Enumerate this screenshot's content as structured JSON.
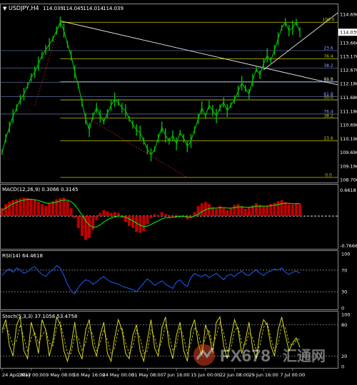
{
  "chart_data": [
    {
      "type": "line",
      "panel": "price",
      "title": "USDJPY,H4",
      "ohlc_header": [
        "114.039",
        "114.045",
        "114.014",
        "114.039"
      ],
      "current_price": "114.039",
      "ylim": [
        108.7,
        114.69
      ],
      "y_ticks": [
        "114.690",
        "113.660",
        "113.170",
        "112.670",
        "112.180",
        "111.680",
        "111.180",
        "110.690",
        "110.190",
        "109.690",
        "109.190",
        "108.700"
      ],
      "x_labels": [
        "24 Apr 2017",
        "2 May 00:00",
        "9 May 08:00",
        "16 May 16:00",
        "24 May 00:00",
        "31 May 08:00",
        "7 Jun 16:00",
        "15 Jun 00:00",
        "22 Jun 08:00",
        "29 Jun 16:00",
        "7 Jul 00:00"
      ],
      "x_index": [
        0,
        8,
        16,
        24,
        32,
        40,
        48,
        56,
        64,
        72,
        80
      ],
      "series": [
        {
          "values": [
            109.7,
            110.2,
            110.6,
            111.0,
            111.3,
            111.6,
            111.8,
            112.1,
            112.4,
            112.6,
            112.9,
            113.2,
            113.4,
            113.6,
            113.8,
            114.1,
            114.4,
            114.1,
            113.6,
            113.2,
            112.6,
            112.1,
            111.5,
            110.9,
            110.5,
            111.0,
            111.3,
            111.0,
            110.8,
            111.1,
            111.4,
            111.6,
            111.5,
            111.3,
            111.2,
            110.9,
            110.7,
            110.5,
            110.4,
            110.1,
            109.8,
            109.6,
            109.8,
            110.2,
            110.6,
            110.3,
            110.1,
            110.3,
            110.0,
            110.4,
            110.2,
            109.9,
            110.1,
            110.5,
            110.9,
            111.3,
            111.0,
            111.4,
            111.2,
            111.0,
            111.3,
            111.5,
            111.2,
            111.4,
            111.6,
            111.9,
            112.2,
            112.0,
            111.8,
            112.3,
            112.7,
            112.5,
            112.9,
            113.2,
            113.0,
            113.4,
            113.8,
            114.2,
            114.4,
            114.1,
            114.2,
            114.4,
            114.039
          ]
        }
      ],
      "fibonacci_left": {
        "high": 114.4,
        "low": 108.78,
        "levels": [
          "100.0",
          "76.4",
          "61.8",
          "50.0",
          "38.2",
          "23.6",
          "0.0"
        ]
      },
      "fibonacci_right": {
        "low": 110.05,
        "high": 114.4,
        "levels": [
          "23.6",
          "38.2",
          "50.0",
          "61.8",
          "76.4"
        ]
      },
      "trendlines": [
        {
          "from": [
            16,
            114.45
          ],
          "to": [
            82,
            112.45
          ]
        },
        {
          "from": [
            72,
            112.68
          ],
          "to": [
            82,
            113.69
          ]
        }
      ],
      "colors": {
        "price": "#00c000",
        "fib": "#c8c800",
        "grid": "#5a6a9a",
        "text": "#ffffff",
        "trend": "#e8e8e8"
      }
    },
    {
      "type": "bar",
      "panel": "macd",
      "title": "MACD(12,26,9) 0.3066 0.3145",
      "y_labels": [
        "0.6618",
        "-0.7666"
      ],
      "ylim": [
        -0.7666,
        0.6618
      ],
      "values": [
        0.2,
        0.3,
        0.36,
        0.4,
        0.42,
        0.44,
        0.46,
        0.45,
        0.43,
        0.4,
        0.36,
        0.3,
        0.25,
        0.32,
        0.38,
        0.42,
        0.45,
        0.46,
        0.38,
        0.2,
        -0.05,
        -0.3,
        -0.5,
        -0.6,
        -0.55,
        -0.35,
        -0.1,
        0.08,
        0.15,
        0.12,
        0.08,
        0.1,
        0.08,
        -0.05,
        -0.15,
        -0.25,
        -0.3,
        -0.4,
        -0.42,
        -0.38,
        -0.2,
        -0.05,
        0.05,
        -0.02,
        0.1,
        0.05,
        -0.05,
        -0.02,
        0.03,
        0.02,
        -0.02,
        -0.08,
        -0.05,
        0.1,
        0.25,
        0.32,
        0.35,
        0.3,
        0.22,
        0.18,
        0.25,
        0.2,
        0.15,
        0.2,
        0.28,
        0.3,
        0.25,
        0.18,
        0.22,
        0.27,
        0.32,
        0.28,
        0.24,
        0.26,
        0.3,
        0.33,
        0.37,
        0.4,
        0.35,
        0.3,
        0.29,
        0.31,
        0.3066
      ],
      "signal": [
        0.15,
        0.2,
        0.26,
        0.31,
        0.35,
        0.38,
        0.4,
        0.42,
        0.42,
        0.41,
        0.39,
        0.36,
        0.33,
        0.32,
        0.33,
        0.35,
        0.38,
        0.4,
        0.4,
        0.36,
        0.28,
        0.16,
        0.02,
        -0.12,
        -0.22,
        -0.28,
        -0.27,
        -0.22,
        -0.15,
        -0.09,
        -0.05,
        -0.02,
        0.0,
        0.0,
        -0.03,
        -0.07,
        -0.12,
        -0.18,
        -0.23,
        -0.26,
        -0.25,
        -0.21,
        -0.16,
        -0.12,
        -0.07,
        -0.04,
        -0.04,
        -0.03,
        -0.02,
        -0.01,
        -0.01,
        -0.02,
        -0.03,
        0.0,
        0.05,
        0.11,
        0.16,
        0.19,
        0.2,
        0.2,
        0.21,
        0.21,
        0.2,
        0.2,
        0.21,
        0.23,
        0.23,
        0.22,
        0.22,
        0.23,
        0.25,
        0.25,
        0.25,
        0.25,
        0.26,
        0.27,
        0.29,
        0.31,
        0.32,
        0.32,
        0.31,
        0.31,
        0.3145
      ],
      "colors": {
        "bars": "#c00000",
        "signal": "#00ff00",
        "zero": "#ffffff"
      }
    },
    {
      "type": "line",
      "panel": "rsi",
      "title": "RSI(14) 64.4618",
      "y_labels": [
        "100",
        "70",
        "30",
        "0"
      ],
      "levels": [
        70,
        30
      ],
      "ylim": [
        0,
        100
      ],
      "values": [
        60,
        68,
        72,
        66,
        74,
        70,
        64,
        67,
        73,
        76,
        68,
        62,
        58,
        66,
        70,
        78,
        74,
        60,
        44,
        32,
        26,
        38,
        46,
        52,
        50,
        44,
        48,
        54,
        58,
        52,
        48,
        46,
        44,
        40,
        38,
        36,
        34,
        30,
        38,
        46,
        54,
        48,
        42,
        46,
        50,
        44,
        40,
        36,
        48,
        52,
        44,
        40,
        56,
        64,
        60,
        58,
        62,
        56,
        60,
        64,
        58,
        52,
        60,
        62,
        58,
        64,
        68,
        62,
        60,
        66,
        70,
        64,
        60,
        66,
        68,
        72,
        70,
        74,
        66,
        62,
        66,
        68,
        64.4618
      ],
      "colors": {
        "line": "#1e5eff",
        "levels": "#8a8a8a"
      }
    },
    {
      "type": "line",
      "panel": "stochastic",
      "title": "Stoch(5,3,3) 37.1058 53.4758",
      "y_labels": [
        "100",
        "80",
        "20",
        "0"
      ],
      "levels": [
        80,
        20
      ],
      "ylim": [
        0,
        100
      ],
      "values": [
        70,
        90,
        40,
        20,
        80,
        95,
        30,
        15,
        85,
        60,
        25,
        90,
        70,
        20,
        50,
        95,
        80,
        30,
        10,
        40,
        85,
        30,
        15,
        70,
        90,
        40,
        20,
        60,
        85,
        25,
        10,
        55,
        90,
        70,
        25,
        15,
        60,
        80,
        30,
        10,
        50,
        90,
        35,
        20,
        75,
        95,
        40,
        15,
        60,
        85,
        30,
        10,
        70,
        90,
        45,
        20,
        80,
        60,
        25,
        85,
        95,
        40,
        15,
        55,
        90,
        70,
        25,
        50,
        85,
        35,
        15,
        65,
        90,
        80,
        40,
        20,
        70,
        95,
        60,
        30,
        45,
        55,
        37.1058
      ],
      "signal": [
        65,
        80,
        60,
        40,
        50,
        80,
        55,
        30,
        55,
        65,
        45,
        60,
        70,
        45,
        40,
        75,
        85,
        55,
        25,
        25,
        60,
        55,
        30,
        45,
        75,
        60,
        30,
        45,
        70,
        50,
        25,
        35,
        70,
        75,
        45,
        25,
        40,
        70,
        55,
        25,
        30,
        70,
        55,
        30,
        50,
        80,
        60,
        30,
        40,
        75,
        55,
        25,
        45,
        75,
        65,
        35,
        55,
        70,
        40,
        60,
        85,
        65,
        30,
        35,
        70,
        75,
        45,
        40,
        65,
        55,
        30,
        40,
        75,
        85,
        55,
        30,
        45,
        80,
        75,
        45,
        40,
        50,
        53.4758
      ],
      "colors": {
        "main": "#d8d820",
        "signal": "#d8d820",
        "levels": "#8a8a8a"
      }
    }
  ],
  "watermark": {
    "fx": "FX678",
    "cn": "汇通网"
  }
}
